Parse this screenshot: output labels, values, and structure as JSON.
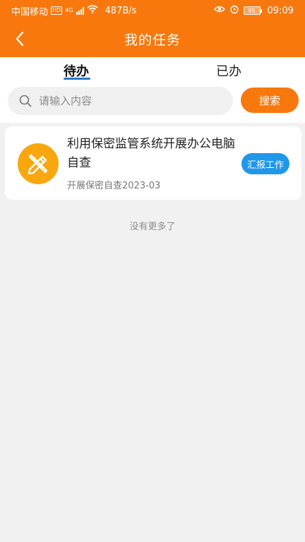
{
  "status_bar": {
    "carrier": "中国移动",
    "hd_label": "HD",
    "network_label": "4G",
    "speed": "487B/s",
    "battery": "85",
    "time": "09:09"
  },
  "header": {
    "title": "我的任务"
  },
  "tabs": [
    {
      "label": "待办",
      "active": true
    },
    {
      "label": "已办",
      "active": false
    }
  ],
  "search": {
    "placeholder": "请输入内容",
    "value": "",
    "button_label": "搜索"
  },
  "tasks": [
    {
      "title": "利用保密监管系统开展办公电脑自查",
      "subtitle": "开展保密自查2023-03",
      "action_label": "汇报工作",
      "icon": "pencil-ruler-icon"
    }
  ],
  "list_footer": "没有更多了",
  "colors": {
    "primary": "#f8780d",
    "tab_indicator": "#2a77c8",
    "task_icon_bg": "#f9a70f",
    "action_button": "#1f97ea",
    "background": "#f2f1f1"
  }
}
